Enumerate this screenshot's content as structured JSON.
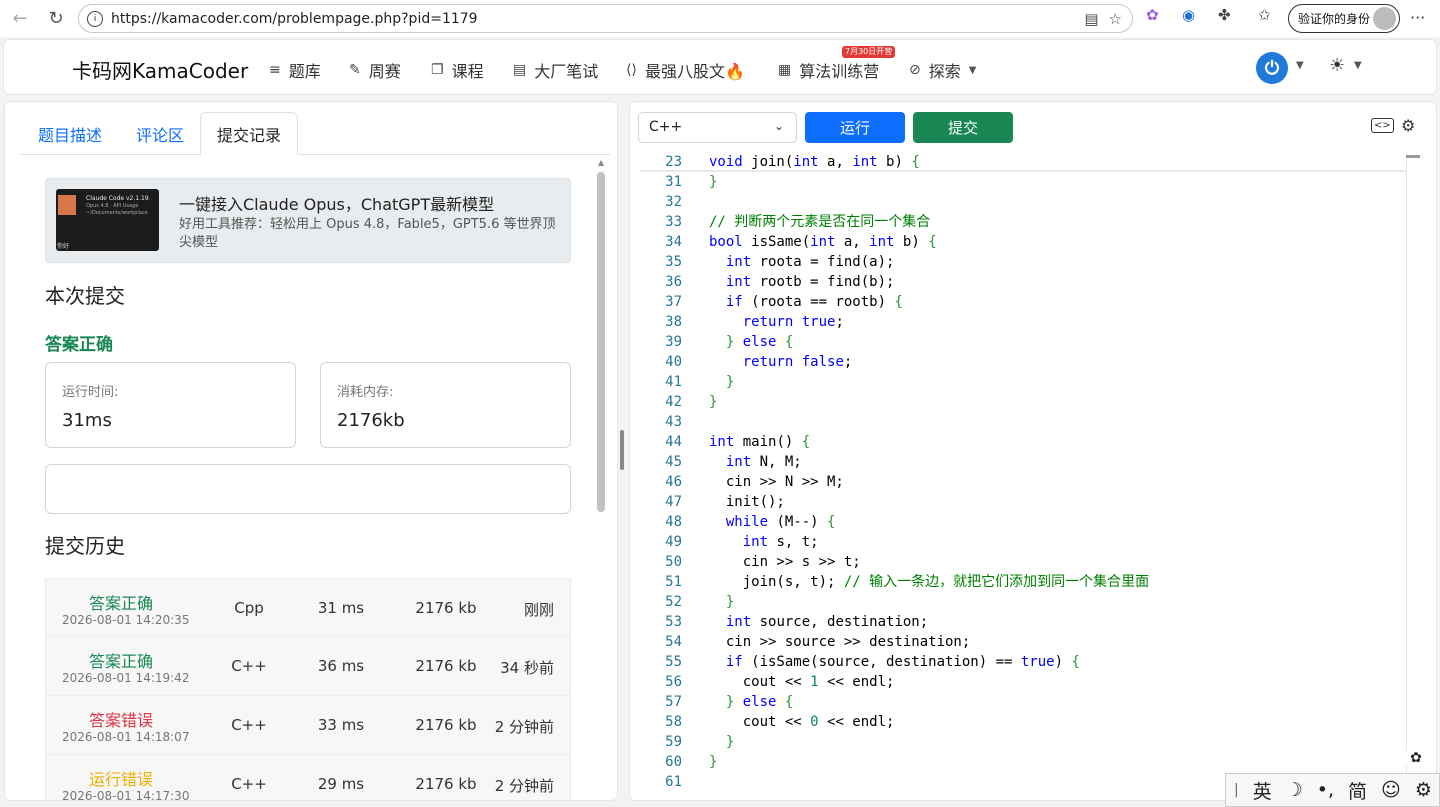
{
  "browser": {
    "url": "https://kamacoder.com/problempage.php?pid=1179",
    "profile_label": "验证你的身份"
  },
  "navbar": {
    "brand": "卡码网KamaCoder",
    "items": [
      {
        "label": "题库",
        "icon": "list-icon"
      },
      {
        "label": "周赛",
        "icon": "pencil-icon"
      },
      {
        "label": "课程",
        "icon": "copy-icon"
      },
      {
        "label": "大厂笔试",
        "icon": "document-icon"
      },
      {
        "label": "最强八股文🔥",
        "icon": "code-icon"
      },
      {
        "label": "算法训练营",
        "icon": "calendar-icon"
      },
      {
        "label": "探索",
        "icon": "compass-icon"
      }
    ],
    "camp_badge": "7月30日开营"
  },
  "left": {
    "tabs": [
      "题目描述",
      "评论区",
      "提交记录"
    ],
    "ad": {
      "image_lines": [
        "Claude Code v2.1.19",
        "Opus 4.8 · API Usage",
        "~/Documents/workplace",
        "你好"
      ],
      "title": "一键接入Claude Opus，ChatGPT最新模型",
      "desc": "好用工具推荐：轻松用上 Opus 4.8，Fable5，GPT5.6 等世界顶尖模型"
    },
    "this_submission": "本次提交",
    "result": "答案正确",
    "runtime_label": "运行时间:",
    "runtime_value": "31ms",
    "memory_label": "消耗内存:",
    "memory_value": "2176kb",
    "history_title": "提交历史",
    "history": [
      {
        "status": "答案正确",
        "cls": "ok",
        "time": "2026-08-01 14:20:35",
        "lang": "Cpp",
        "runtime": "31 ms",
        "memory": "2176 kb",
        "ago": "刚刚"
      },
      {
        "status": "答案正确",
        "cls": "ok",
        "time": "2026-08-01 14:19:42",
        "lang": "C++",
        "runtime": "36 ms",
        "memory": "2176 kb",
        "ago": "34 秒前"
      },
      {
        "status": "答案错误",
        "cls": "err",
        "time": "2026-08-01 14:18:07",
        "lang": "C++",
        "runtime": "33 ms",
        "memory": "2176 kb",
        "ago": "2 分钟前"
      },
      {
        "status": "运行错误",
        "cls": "rte",
        "time": "2026-08-01 14:17:30",
        "lang": "C++",
        "runtime": "29 ms",
        "memory": "2176 kb",
        "ago": "2 分钟前"
      }
    ]
  },
  "editor": {
    "language": "C++",
    "run_label": "运行",
    "submit_label": "提交",
    "lines": [
      {
        "n": "23",
        "html": "<span class=\"kw\">void</span> join(<span class=\"kw\">int</span> a, <span class=\"kw\">int</span> b) <span class=\"br\">{</span>"
      },
      {
        "n": "31",
        "html": "<span class=\"br\">}</span>"
      },
      {
        "n": "32",
        "html": ""
      },
      {
        "n": "33",
        "html": "<span class=\"cm\">// 判断两个元素是否在同一个集合</span>"
      },
      {
        "n": "34",
        "html": "<span class=\"kw\">bool</span> isSame(<span class=\"kw\">int</span> a, <span class=\"kw\">int</span> b) <span class=\"br\">{</span>"
      },
      {
        "n": "35",
        "html": "  <span class=\"kw\">int</span> roota = find(a);"
      },
      {
        "n": "36",
        "html": "  <span class=\"kw\">int</span> rootb = find(b);"
      },
      {
        "n": "37",
        "html": "  <span class=\"kw\">if</span> (roota == rootb) <span class=\"br\">{</span>"
      },
      {
        "n": "38",
        "html": "    <span class=\"kw\">return</span> <span class=\"kw\">true</span>;"
      },
      {
        "n": "39",
        "html": "  <span class=\"br\">}</span> <span class=\"kw\">else</span> <span class=\"br\">{</span>"
      },
      {
        "n": "40",
        "html": "    <span class=\"kw\">return</span> <span class=\"kw\">false</span>;"
      },
      {
        "n": "41",
        "html": "  <span class=\"br\">}</span>"
      },
      {
        "n": "42",
        "html": "<span class=\"br\">}</span>"
      },
      {
        "n": "43",
        "html": ""
      },
      {
        "n": "44",
        "html": "<span class=\"kw\">int</span> main() <span class=\"br\">{</span>"
      },
      {
        "n": "45",
        "html": "  <span class=\"kw\">int</span> N, M;"
      },
      {
        "n": "46",
        "html": "  cin >> N >> M;"
      },
      {
        "n": "47",
        "html": "  init();"
      },
      {
        "n": "48",
        "html": "  <span class=\"kw\">while</span> (M--) <span class=\"br\">{</span>"
      },
      {
        "n": "49",
        "html": "    <span class=\"kw\">int</span> s, t;"
      },
      {
        "n": "50",
        "html": "    cin >> s >> t;"
      },
      {
        "n": "51",
        "html": "    join(s, t); <span class=\"cm\">// 输入一条边，就把它们添加到同一个集合里面</span>"
      },
      {
        "n": "52",
        "html": "  <span class=\"br\">}</span>"
      },
      {
        "n": "53",
        "html": "  <span class=\"kw\">int</span> source, destination;"
      },
      {
        "n": "54",
        "html": "  cin >> source >> destination;"
      },
      {
        "n": "55",
        "html": "  <span class=\"kw\">if</span> (isSame(source, destination) == <span class=\"kw\">true</span>) <span class=\"br\">{</span>"
      },
      {
        "n": "56",
        "html": "    cout << <span class=\"nm\">1</span> << endl;"
      },
      {
        "n": "57",
        "html": "  <span class=\"br\">}</span> <span class=\"kw\">else</span> <span class=\"br\">{</span>"
      },
      {
        "n": "58",
        "html": "    cout << <span class=\"nm\">0</span> << endl;"
      },
      {
        "n": "59",
        "html": "  <span class=\"br\">}</span>"
      },
      {
        "n": "60",
        "html": "<span class=\"br\">}</span>"
      },
      {
        "n": "61",
        "html": ""
      }
    ]
  },
  "ime": {
    "items": [
      "英",
      "☽",
      "•,",
      "简",
      "☺",
      "⚙"
    ]
  }
}
